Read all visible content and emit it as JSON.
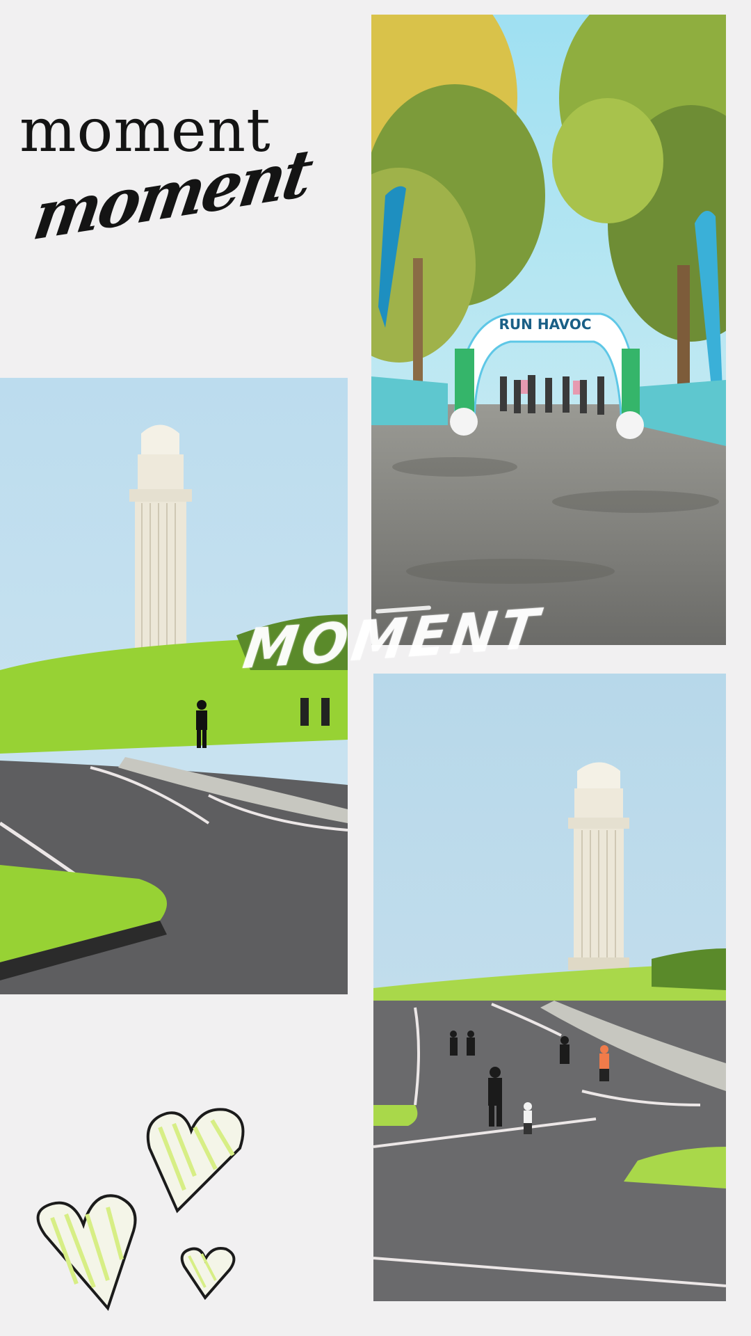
{
  "title": {
    "serif": "moment",
    "script": "moment"
  },
  "photos": {
    "arch": {
      "arch_banner": "RUN HAVOC"
    },
    "overlay_text": "MOMENT"
  },
  "colors": {
    "background": "#f1f0f1",
    "sky": "#b8dbef",
    "grass": "#8fd12a",
    "road": "#5e5e5e",
    "arch_blue": "#5ec7e6",
    "heart_fill": "#e6f59b"
  },
  "decorations": {
    "hearts": [
      "heart-icon",
      "heart-icon",
      "heart-icon"
    ]
  }
}
